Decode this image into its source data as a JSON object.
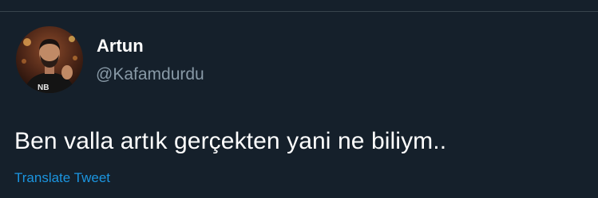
{
  "tweet": {
    "author": {
      "display_name": "Artun",
      "handle": "@Kafamdurdu",
      "avatar_icon": "profile-photo"
    },
    "text": "Ben valla artık gerçekten yani ne biliym..",
    "translate_label": "Translate Tweet"
  },
  "colors": {
    "background": "#15202b",
    "divider": "#38444d",
    "primary_text": "#ffffff",
    "secondary_text": "#8899a6",
    "link": "#1b95e0"
  }
}
